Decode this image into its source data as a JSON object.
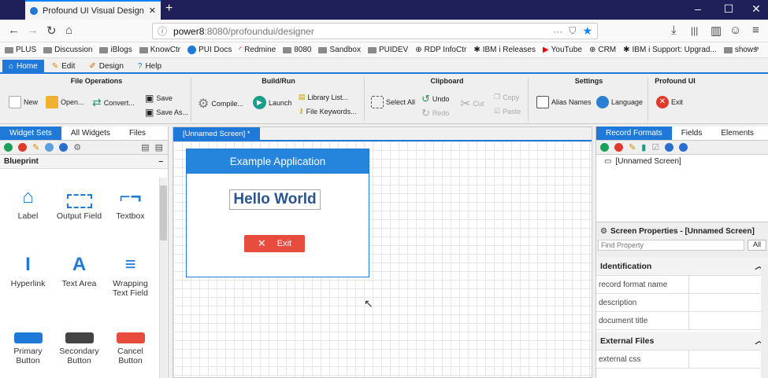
{
  "browser": {
    "tab_title": "Profound UI Visual Designer",
    "url_host": "power8",
    "url_rest": ":8080/profoundui/designer"
  },
  "bookmarks": [
    "PLUS",
    "Discussion",
    "iBlogs",
    "KnowCtr",
    "PUI Docs",
    "Redmine",
    "8080",
    "Sandbox",
    "PUIDEV",
    "RDP InfoCtr",
    "IBM i Releases",
    "YouTube",
    "CRM",
    "IBM i Support: Upgrad...",
    "shows"
  ],
  "ribbon_tabs": [
    "Home",
    "Edit",
    "Design",
    "Help"
  ],
  "groups": {
    "file": "File Operations",
    "build": "Build/Run",
    "clip": "Clipboard",
    "settings": "Settings",
    "pui": "Profound UI"
  },
  "buttons": {
    "new": "New",
    "open": "Open...",
    "convert": "Convert...",
    "save": "Save",
    "save_as": "Save As...",
    "compile": "Compile...",
    "launch": "Launch",
    "library": "Library List...",
    "keywords": "File Keywords...",
    "select_all": "Select All",
    "undo": "Undo",
    "redo": "Redo",
    "cut": "Cut",
    "copy": "Copy",
    "paste": "Paste",
    "alias": "Alias Names",
    "language": "Language",
    "exit": "Exit"
  },
  "left": {
    "tabs": [
      "Widget Sets",
      "All Widgets",
      "Files"
    ],
    "set": "Blueprint",
    "widgets": [
      "Label",
      "Output Field",
      "Textbox",
      "Hyperlink",
      "Text Area",
      "Wrapping Text Field",
      "Primary Button",
      "Secondary Button",
      "Cancel Button"
    ]
  },
  "canvas": {
    "tab": "[Unnamed Screen] *",
    "panel_title": "Example Application",
    "heading": "Hello World",
    "exit": "Exit"
  },
  "right": {
    "tabs": [
      "Record Formats",
      "Fields",
      "Elements"
    ],
    "tree_item": "[Unnamed Screen]",
    "props_title": "Screen Properties - [Unnamed Screen]",
    "find_placeholder": "Find Property",
    "all": "All",
    "sec1": "Identification",
    "props": [
      "record format name",
      "description",
      "document title"
    ],
    "sec2": "External Files",
    "props2": [
      "external css"
    ]
  },
  "colors": {
    "accent": "#1e79d8",
    "exit": "#e84c3d"
  }
}
